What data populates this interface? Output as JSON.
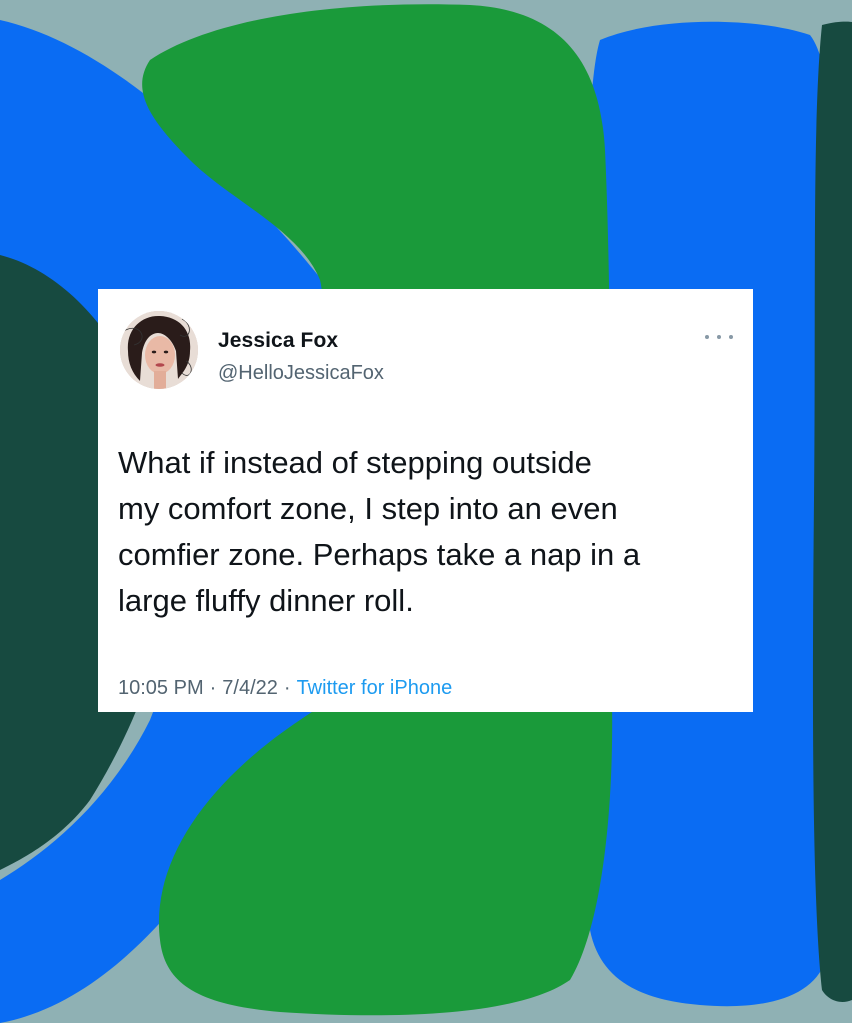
{
  "colors": {
    "background": "#8fb1b4",
    "blue_shape": "#0a6cf3",
    "green_shape": "#1a9a3a",
    "dark_teal_shape": "#174a40",
    "link": "#1d9bf0",
    "secondary_text": "#536471"
  },
  "tweet": {
    "display_name": "Jessica Fox",
    "handle": "@HelloJessicaFox",
    "more_icon": "more-dots-icon",
    "text": "What if instead of stepping outside\nmy comfort zone, I step into an even\ncomfier zone. Perhaps take a nap in a\nlarge fluffy dinner roll.",
    "time": "10:05 PM",
    "separator": "·",
    "date": "7/4/22",
    "source": "Twitter for iPhone"
  }
}
